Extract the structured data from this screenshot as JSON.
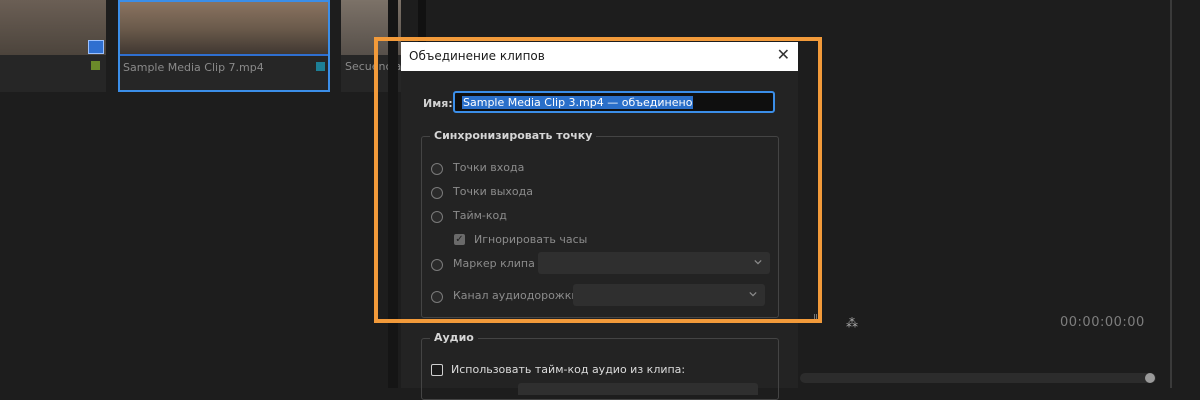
{
  "project_panel": {
    "clips": [
      {
        "label": ""
      },
      {
        "label": "Sample Media Clip 7.mp4"
      },
      {
        "label": "Secuencia"
      }
    ]
  },
  "monitor": {
    "timecode": "00:00:00:00"
  },
  "dialog": {
    "title": "Объединение клипов",
    "close_glyph": "✕",
    "name_label": "Имя:",
    "name_value": "Sample Media Clip 3.mp4 — объединено",
    "sync_group": {
      "legend": "Синхронизировать точку",
      "options": [
        {
          "label": "Точки входа"
        },
        {
          "label": "Точки выхода"
        },
        {
          "label": "Тайм-код"
        }
      ],
      "ignore_hours": {
        "label": "Игнорировать часы",
        "checked": true
      },
      "clip_marker": {
        "label": "Маркер клипа",
        "value": ""
      },
      "audio_channel": {
        "label": "Канал аудиодорожки",
        "value": ""
      }
    },
    "audio_group": {
      "legend": "Аудио",
      "use_timecode": {
        "label": "Использовать тайм-код аудио из клипа:",
        "checked": false
      }
    }
  },
  "colors": {
    "highlight": "#f29a3a",
    "accent": "#3b8ee8",
    "selection": "#2a6fc9"
  }
}
